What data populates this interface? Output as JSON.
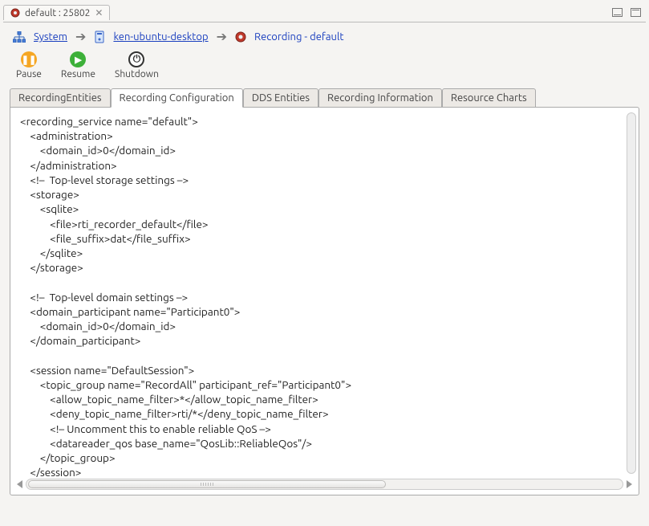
{
  "window": {
    "tab_title": "default : 25802"
  },
  "breadcrumb": {
    "system": "System",
    "host": "ken-ubuntu-desktop",
    "recording": "Recording - default"
  },
  "toolbar": {
    "pause": "Pause",
    "resume": "Resume",
    "shutdown": "Shutdown"
  },
  "tabs": {
    "t1": "RecordingEntities",
    "t2": "Recording Configuration",
    "t3": "DDS Entities",
    "t4": "Recording Information",
    "t5": "Resource Charts"
  },
  "xml": "<recording_service name=\"default\">\n    <administration>\n        <domain_id>0</domain_id>\n    </administration>\n    <!–  Top-level storage settings –>\n    <storage>\n        <sqlite>\n            <file>rti_recorder_default</file>\n            <file_suffix>dat</file_suffix>\n        </sqlite>\n    </storage>\n\n    <!–  Top-level domain settings –>\n    <domain_participant name=\"Participant0\">\n        <domain_id>0</domain_id>\n    </domain_participant>\n\n    <session name=\"DefaultSession\">\n        <topic_group name=\"RecordAll\" participant_ref=\"Participant0\">\n            <allow_topic_name_filter>*</allow_topic_name_filter>\n            <deny_topic_name_filter>rti/*</deny_topic_name_filter>\n            <!– Uncomment this to enable reliable QoS –>\n            <datareader_qos base_name=\"QosLib::ReliableQos\"/>\n        </topic_group>\n    </session>\n</recording_service>"
}
